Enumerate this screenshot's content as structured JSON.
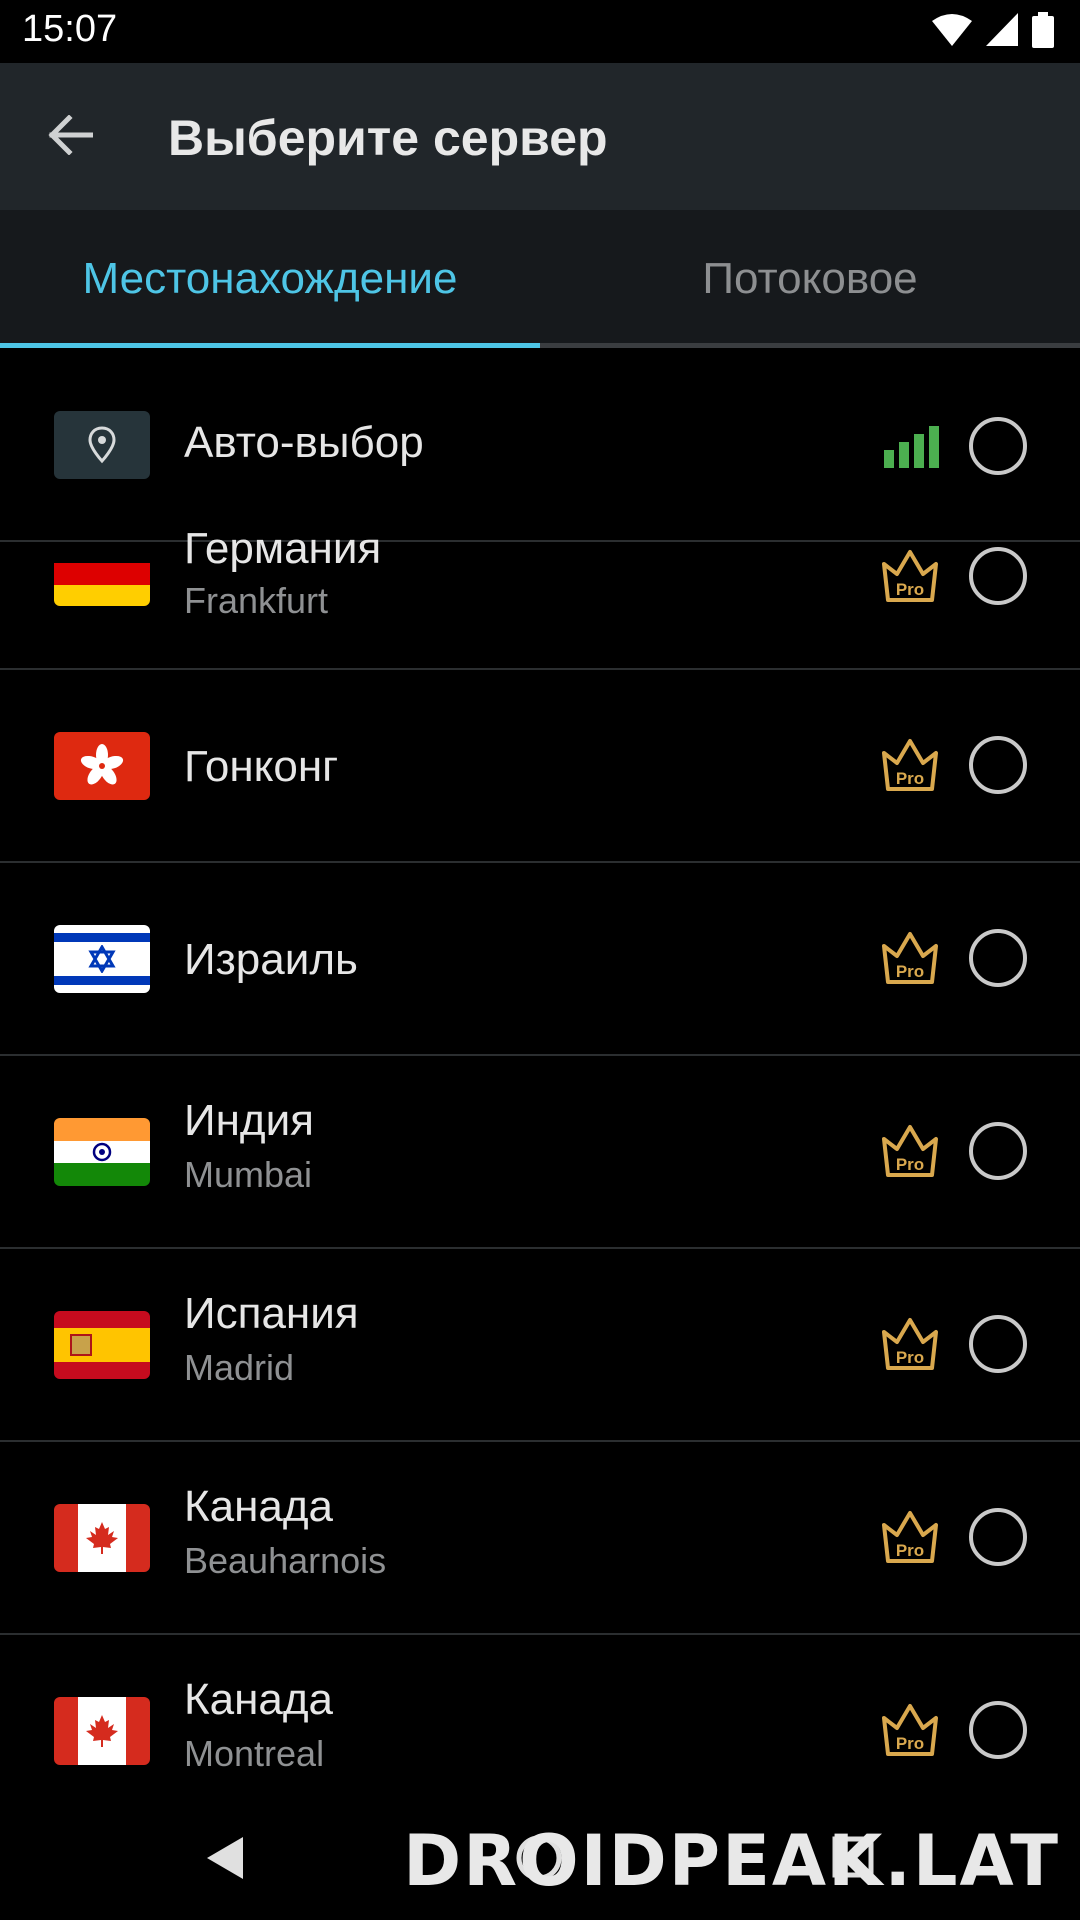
{
  "status": {
    "time": "15:07"
  },
  "appbar": {
    "title": "Выберите сервер"
  },
  "tabs": [
    {
      "label": "Местонахождение"
    },
    {
      "label": "Потоковое"
    }
  ],
  "auto": {
    "label": "Авто-выбор"
  },
  "servers": [
    {
      "country": "Германия",
      "city": "Frankfurt",
      "badge": "Pro"
    },
    {
      "country": "Гонконг",
      "city": "",
      "badge": "Pro"
    },
    {
      "country": "Израиль",
      "city": "",
      "badge": "Pro"
    },
    {
      "country": "Индия",
      "city": "Mumbai",
      "badge": "Pro"
    },
    {
      "country": "Испания",
      "city": "Madrid",
      "badge": "Pro"
    },
    {
      "country": "Канада",
      "city": "Beauharnois",
      "badge": "Pro"
    },
    {
      "country": "Канада",
      "city": "Montreal",
      "badge": "Pro"
    }
  ],
  "watermark": "DROIDPEAK.LAT",
  "colors": {
    "accent": "#4ec5e6",
    "signal": "#4caf50",
    "crown": "#d9a84e"
  }
}
